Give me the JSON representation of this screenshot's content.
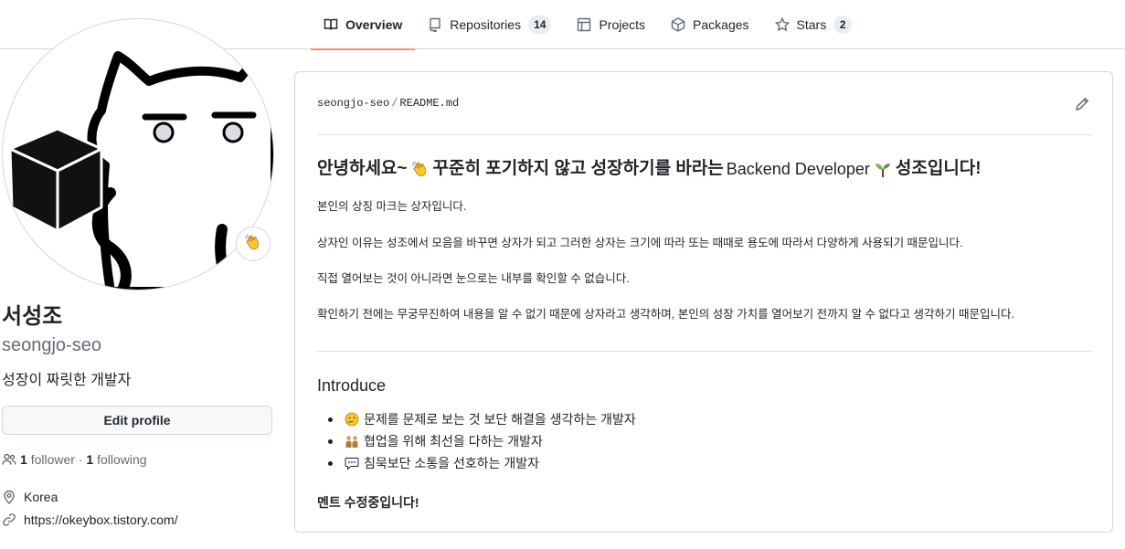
{
  "nav": {
    "tabs": [
      {
        "label": "Overview",
        "icon": "book-icon",
        "active": true
      },
      {
        "label": "Repositories",
        "icon": "repo-icon",
        "count": "14"
      },
      {
        "label": "Projects",
        "icon": "table-icon"
      },
      {
        "label": "Packages",
        "icon": "package-icon"
      },
      {
        "label": "Stars",
        "icon": "star-icon",
        "count": "2"
      }
    ]
  },
  "profile": {
    "name": "서성조",
    "username": "seongjo-seo",
    "bio": "성장이 짜릿한 개발자",
    "edit_label": "Edit profile",
    "followers_count": "1",
    "followers_label": "follower",
    "separator": "·",
    "following_count": "1",
    "following_label": "following",
    "location": "Korea",
    "website": "https://okeybox.tistory.com/",
    "status_emoji": "waving-hand-icon"
  },
  "readme": {
    "owner": "seongjo-seo",
    "path_sep": "/",
    "file": "README.md",
    "heading_part1": "안녕하세요~",
    "heading_part2": "꾸준히 포기하지 않고 성장하기를 바라는",
    "heading_en": "Backend Developer",
    "heading_part3": "성조입니다!",
    "p1": "본인의 상징 마크는 상자입니다.",
    "p2": "상자인 이유는 성조에서 모음을 바꾸면 상자가 되고 그러한 상자는 크기에 따라 또는 때때로 용도에 따라서 다양하게 사용되기 때문입니다.",
    "p3": "직접 열어보는 것이 아니라면 눈으로는 내부를 확인할 수 없습니다.",
    "p4": "확인하기 전에는 무궁무진하여 내용을 알 수 없기 때문에 상자라고 생각하며, 본인의 성장 가치를 열어보기 전까지 알 수 없다고 생각하기 때문입니다.",
    "intro_heading": "Introduce",
    "intro_items": [
      {
        "emoji": "thinking-face-icon",
        "text": "문제를 문제로 보는 것 보단 해결을 생각하는 개발자"
      },
      {
        "emoji": "people-icon",
        "text": "협업을 위해 최선을 다하는 개발자"
      },
      {
        "emoji": "speech-balloon-icon",
        "text": "침묵보단 소통을 선호하는 개발자"
      }
    ],
    "notice": "멘트 수정중입니다!"
  },
  "colors": {
    "tab_underline": "#fd8c73",
    "text": "#1f2328",
    "muted": "#636c76",
    "border": "#d0d7de"
  }
}
